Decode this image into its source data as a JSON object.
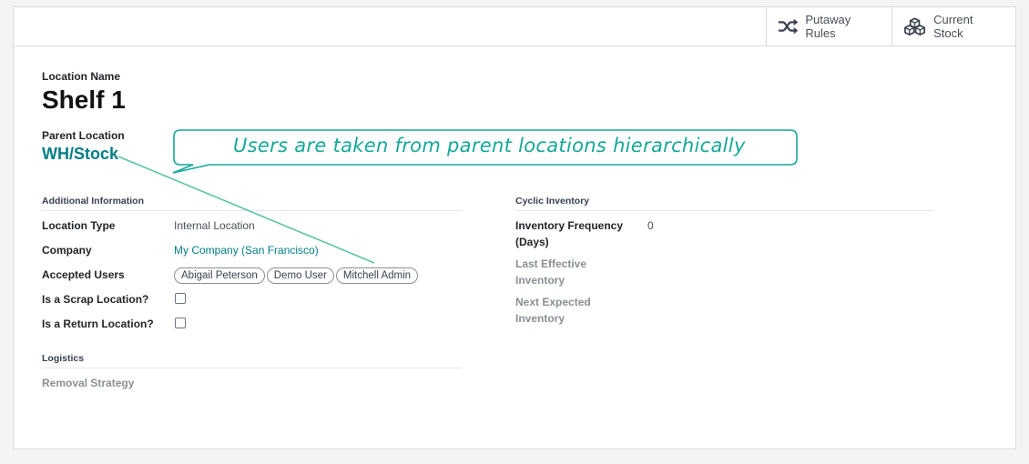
{
  "toolbar": {
    "putaway": {
      "label": "Putaway Rules",
      "icon": "shuffle-arrows-icon"
    },
    "stock": {
      "label": "Current Stock",
      "icon": "cubes-icon"
    }
  },
  "form": {
    "name_label": "Location Name",
    "name": "Shelf 1",
    "parent_label": "Parent Location",
    "parent": "WH/Stock"
  },
  "callout": {
    "text": "Users are taken from parent locations hierarchically",
    "color": "#16a899"
  },
  "additional": {
    "title": "Additional Information",
    "location_type_label": "Location Type",
    "location_type": "Internal Location",
    "company_label": "Company",
    "company": "My Company (San Francisco)",
    "accepted_users_label": "Accepted Users",
    "accepted_users": [
      "Abigail Peterson",
      "Demo User",
      "Mitchell Admin"
    ],
    "scrap_label": "Is a Scrap Location?",
    "scrap": false,
    "return_label": "Is a Return Location?",
    "return": false
  },
  "logistics": {
    "title": "Logistics",
    "removal_label": "Removal Strategy"
  },
  "cyclic": {
    "title": "Cyclic Inventory",
    "frequency_label_1": "Inventory Frequency",
    "frequency_label_2": "(Days)",
    "frequency": "0",
    "last_label_1": "Last Effective",
    "last_label_2": "Inventory",
    "next_label_1": "Next Expected",
    "next_label_2": "Inventory"
  },
  "colors": {
    "accent": "#017e84",
    "callout": "#16a899"
  }
}
